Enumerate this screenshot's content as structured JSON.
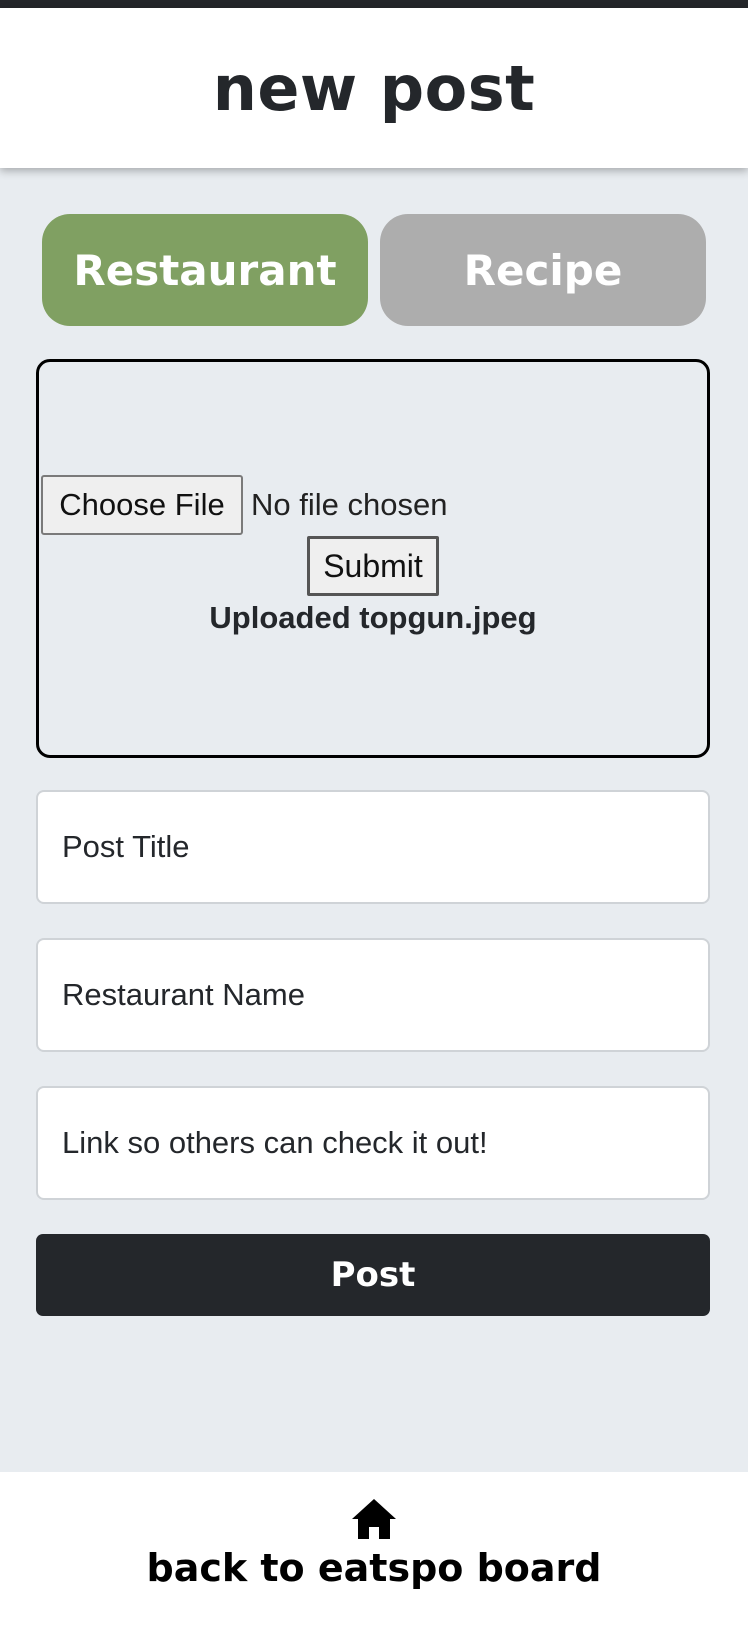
{
  "header": {
    "title": "new post"
  },
  "post_type_toggle": {
    "restaurant_label": "Restaurant",
    "recipe_label": "Recipe",
    "selected": "Restaurant",
    "colors": {
      "active": "#80a062",
      "inactive": "#adadad"
    }
  },
  "upload": {
    "choose_file_label": "Choose File",
    "file_status": "No file chosen",
    "submit_label": "Submit",
    "uploaded_message": "Uploaded topgun.jpeg"
  },
  "form": {
    "post_title_placeholder": "Post Title",
    "restaurant_name_placeholder": "Restaurant Name",
    "link_placeholder": "Link so others can check it out!",
    "post_button_label": "Post"
  },
  "footer": {
    "home_icon": "home-icon",
    "back_link_label": "back to eatspo board"
  }
}
